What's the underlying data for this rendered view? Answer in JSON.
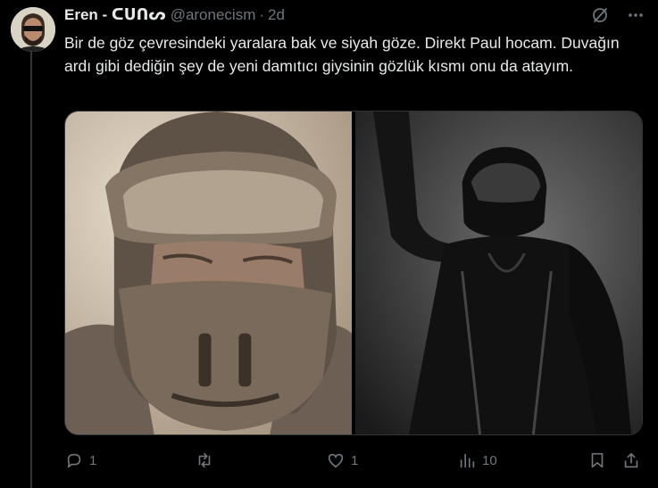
{
  "tweet": {
    "display_name": "Eren - ᑕᑌᑎᔕ",
    "handle": "@aronecism",
    "separator": "·",
    "time": "2d",
    "text": "Bir de göz çevresindeki yaralara bak ve siyah göze. Direkt Paul hocam. Duvağın ardı gibi dediğin şey de yeni damıtıcı giysinin gözlük kısmı onu da atayım."
  },
  "top_actions": {
    "grok_icon": "grok-icon",
    "more_icon": "more-icon"
  },
  "media": [
    {
      "name": "sandy-stillsuit-mask-photo"
    },
    {
      "name": "black-stillsuit-raised-fist-photo"
    }
  ],
  "actions": {
    "replies": "1",
    "reposts": "",
    "likes": "1",
    "views": "10"
  },
  "colors": {
    "background": "#000000",
    "text": "#e7e9ea",
    "muted": "#71767b",
    "border": "#2f3336"
  }
}
